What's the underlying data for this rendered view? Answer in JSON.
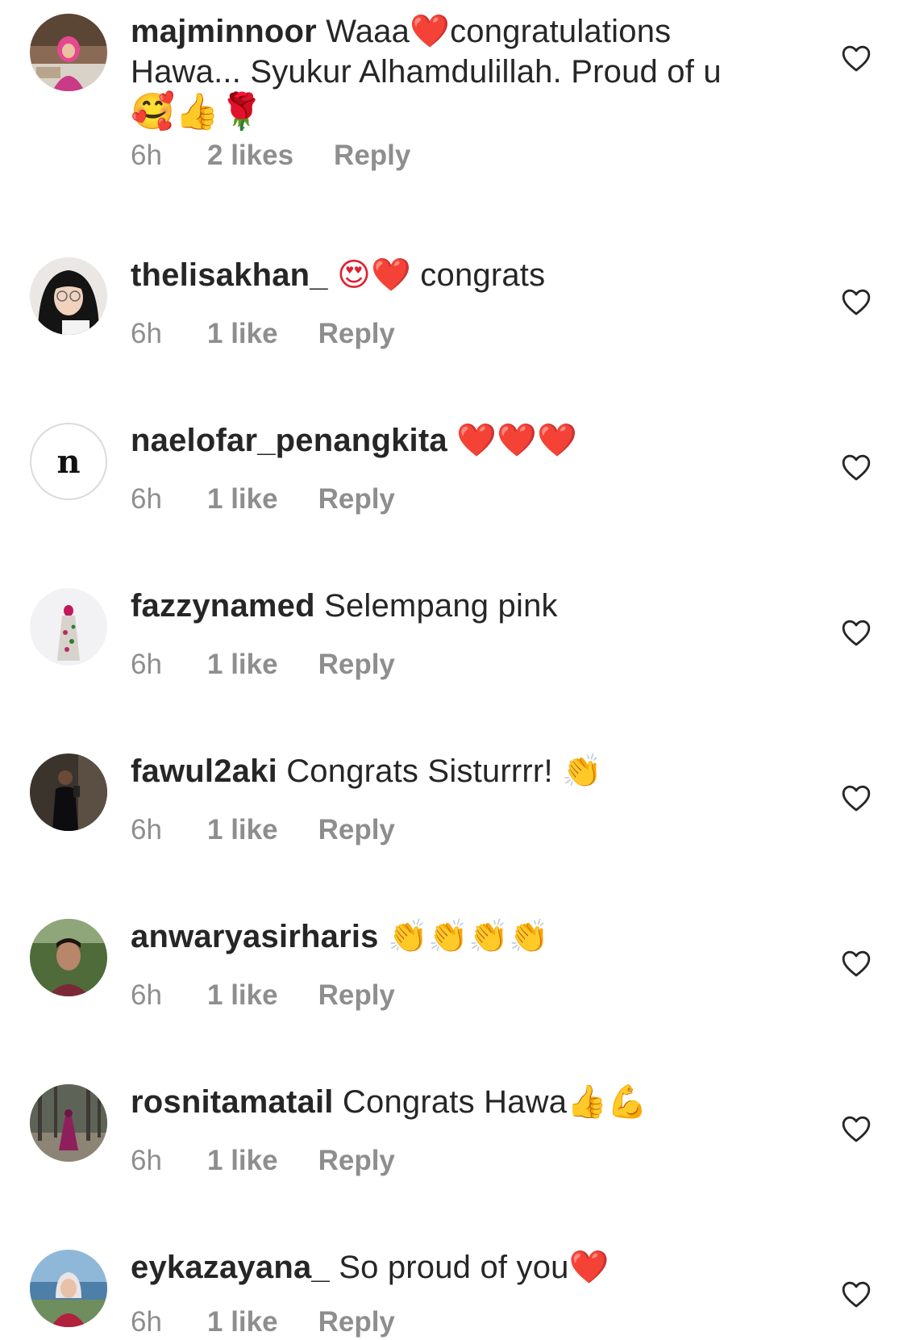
{
  "comments": [
    {
      "username": "majminnoor",
      "text_line1": "Waaa",
      "text_line1_emoji": "❤️",
      "text_line1_after": "congratulations",
      "text_line2": "Hawa... Syukur Alhamdulillah. Proud of u",
      "text_line3_emojis": "🥰👍🌹",
      "time": "6h",
      "likes": "2 likes",
      "reply": "Reply"
    },
    {
      "username": "thelisakhan_",
      "emojis": "😍❤️",
      "text": "congrats",
      "time": "6h",
      "likes": "1 like",
      "reply": "Reply"
    },
    {
      "username": "naelofar_penangkita",
      "emojis": "❤️❤️❤️",
      "avatar_letter": "n",
      "time": "6h",
      "likes": "1 like",
      "reply": "Reply"
    },
    {
      "username": "fazzynamed",
      "text": "Selempang pink",
      "time": "6h",
      "likes": "1 like",
      "reply": "Reply"
    },
    {
      "username": "fawul2aki",
      "text": "Congrats Sisturrrr!",
      "emojis": "👏",
      "time": "6h",
      "likes": "1 like",
      "reply": "Reply"
    },
    {
      "username": "anwaryasirharis",
      "emojis": "👏👏👏👏",
      "time": "6h",
      "likes": "1 like",
      "reply": "Reply"
    },
    {
      "username": "rosnitamatail",
      "text": "Congrats Hawa",
      "emojis": "👍💪",
      "time": "6h",
      "likes": "1 like",
      "reply": "Reply"
    },
    {
      "username": "eykazayana_",
      "text": "So proud of you",
      "emojis": "❤️",
      "time": "6h",
      "likes": "1 like",
      "reply": "Reply"
    }
  ],
  "colors": {
    "text": "#262626",
    "meta": "#8e8e8e",
    "heart_emoji": "#e0202e",
    "background": "#ffffff"
  },
  "icons": {
    "like": "heart-outline-icon"
  }
}
